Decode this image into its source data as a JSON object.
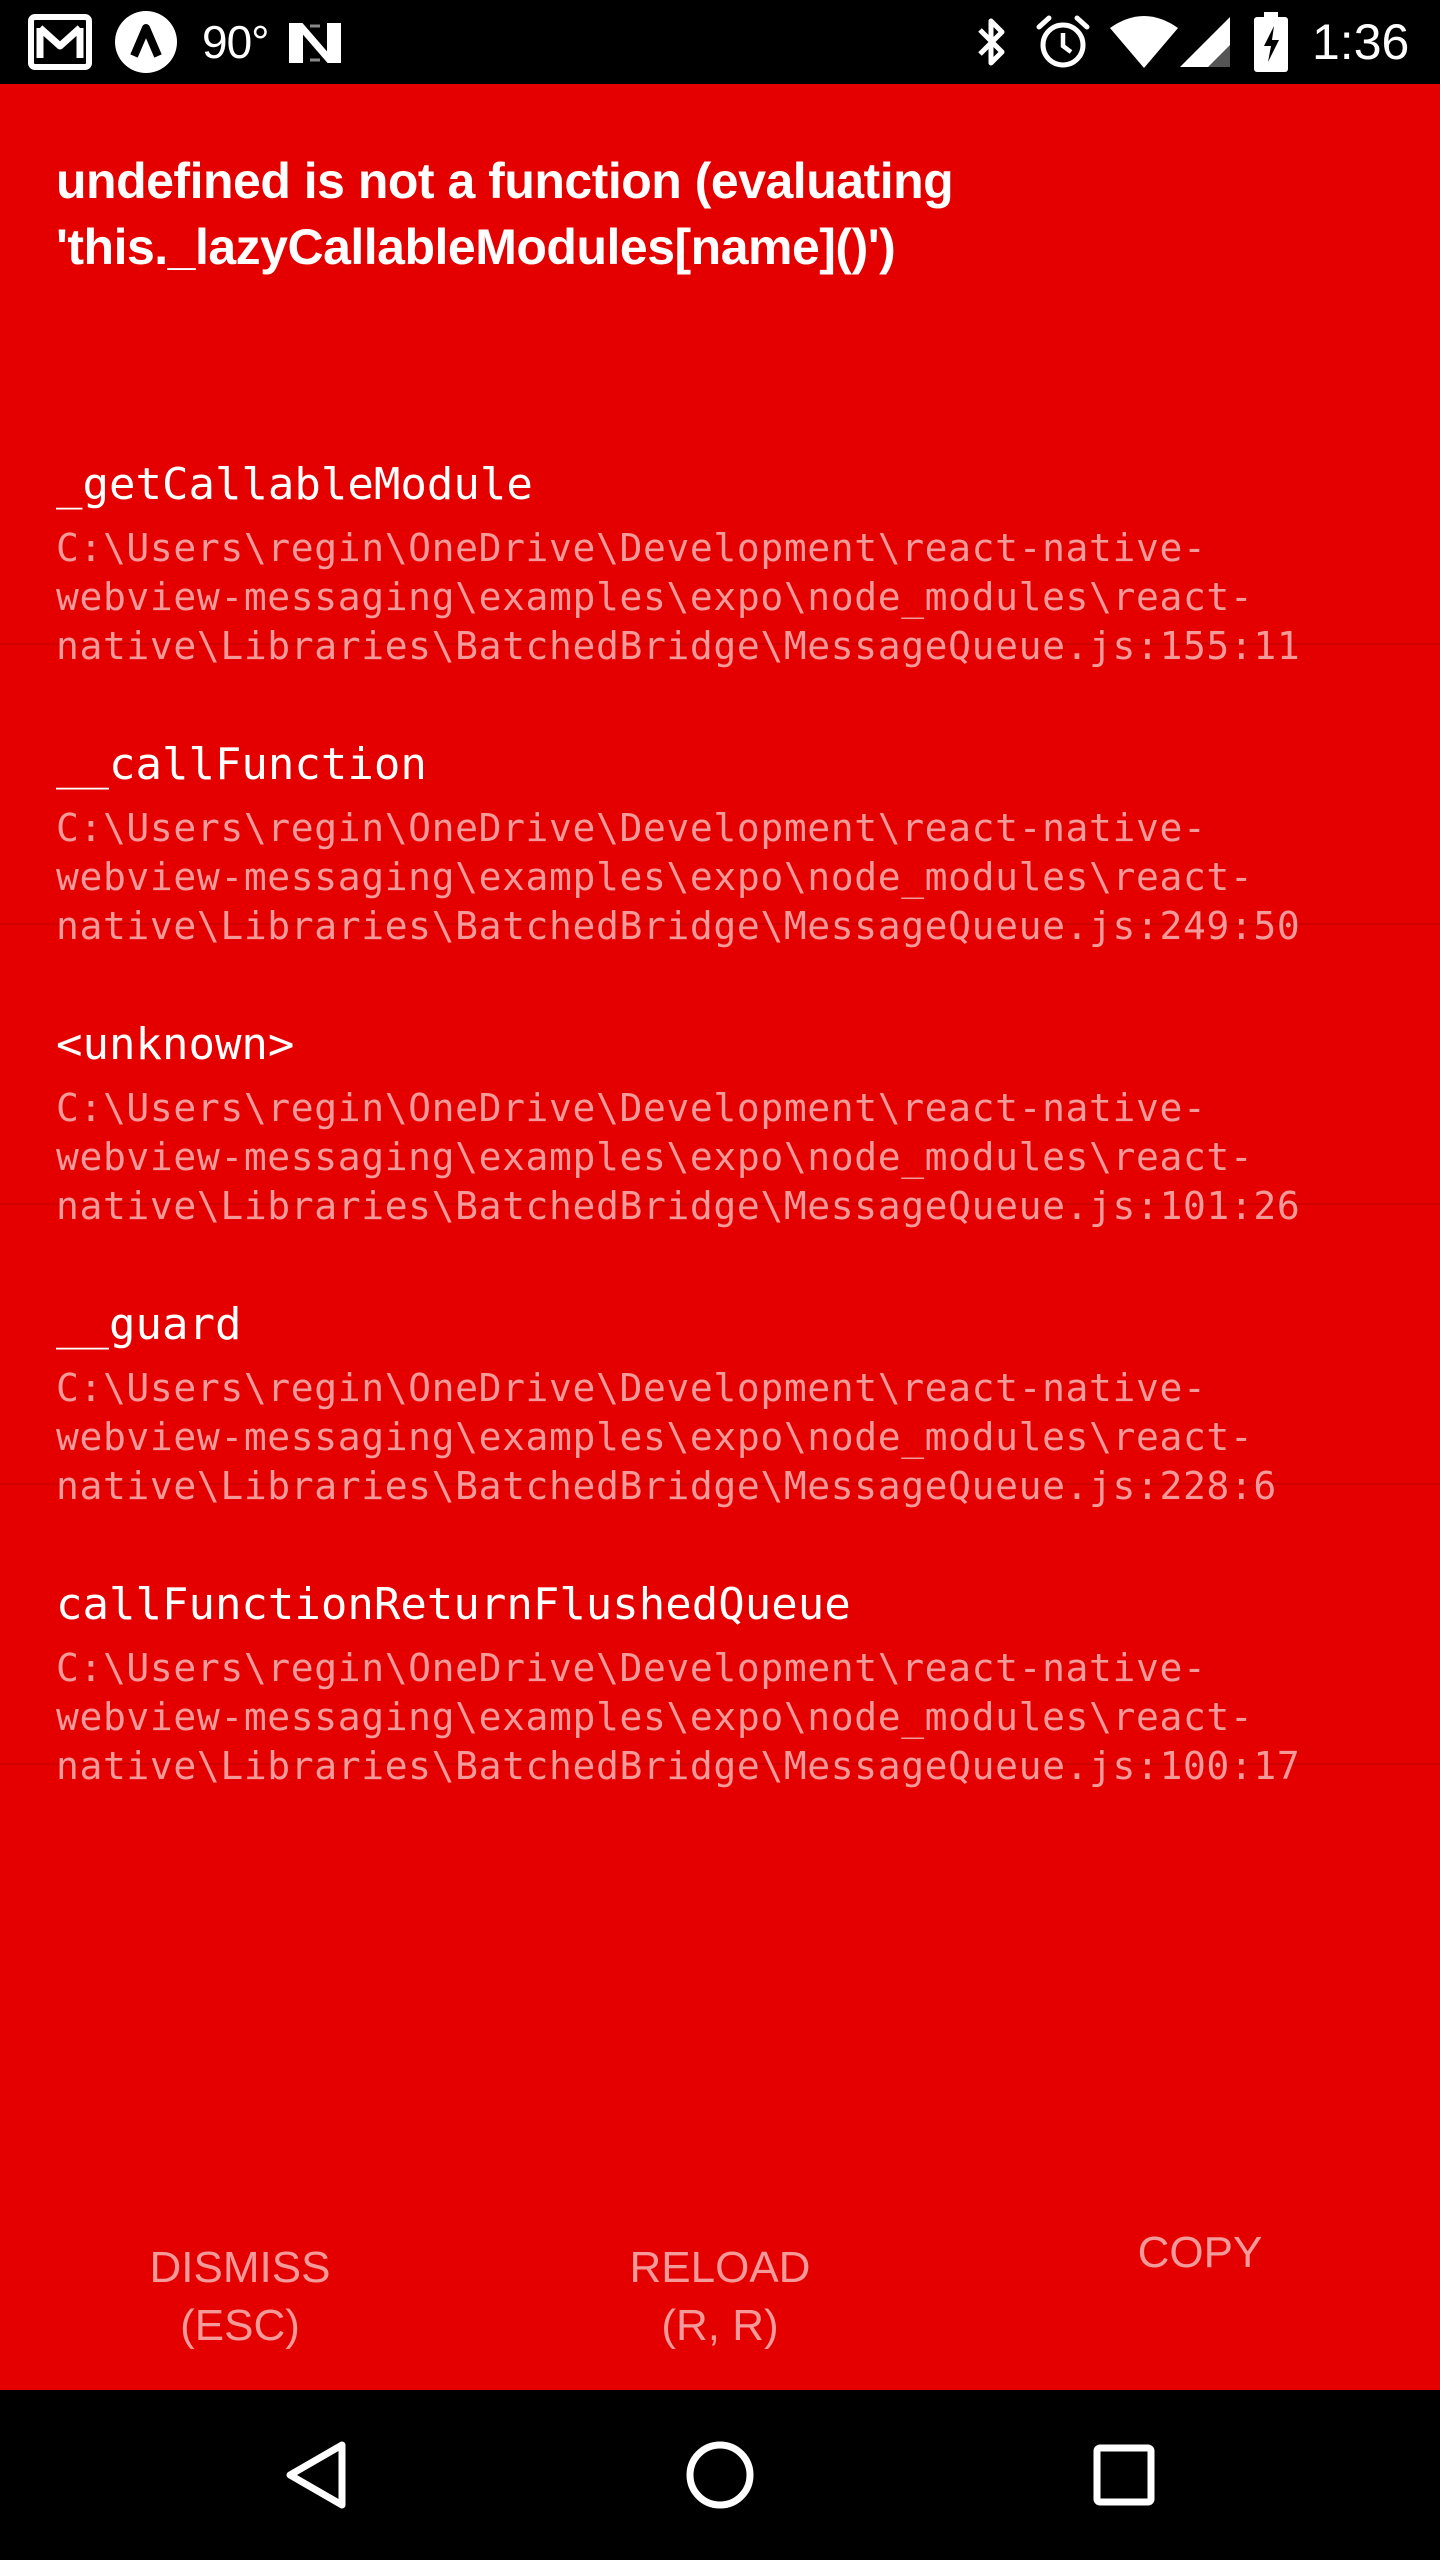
{
  "status_bar": {
    "temperature": "90°",
    "time": "1:36",
    "icons": [
      "gmail-icon",
      "app-a-icon",
      "n-app-icon",
      "bluetooth-icon",
      "alarm-icon",
      "wifi-icon",
      "cell-signal-icon",
      "battery-charging-icon"
    ]
  },
  "error": {
    "title": "undefined is not a function (evaluating 'this._lazyCallableModules[name]()')"
  },
  "stack": [
    {
      "method": "_getCallableModule",
      "file_lines": [
        "C:\\Users\\regin\\OneDrive\\Development\\react-native-",
        "webview-messaging\\examples\\expo\\node_modules\\react-",
        "native\\Libraries\\BatchedBridge\\MessageQueue.js:155:11"
      ]
    },
    {
      "method": "__callFunction",
      "file_lines": [
        "C:\\Users\\regin\\OneDrive\\Development\\react-native-",
        "webview-messaging\\examples\\expo\\node_modules\\react-",
        "native\\Libraries\\BatchedBridge\\MessageQueue.js:249:50"
      ]
    },
    {
      "method": "<unknown>",
      "file_lines": [
        "C:\\Users\\regin\\OneDrive\\Development\\react-native-",
        "webview-messaging\\examples\\expo\\node_modules\\react-",
        "native\\Libraries\\BatchedBridge\\MessageQueue.js:101:26"
      ]
    },
    {
      "method": "__guard",
      "file_lines": [
        "C:\\Users\\regin\\OneDrive\\Development\\react-native-",
        "webview-messaging\\examples\\expo\\node_modules\\react-",
        "native\\Libraries\\BatchedBridge\\MessageQueue.js:228:6"
      ]
    },
    {
      "method": "callFunctionReturnFlushedQueue",
      "file_lines": [
        "C:\\Users\\regin\\OneDrive\\Development\\react-native-",
        "webview-messaging\\examples\\expo\\node_modules\\react-",
        "native\\Libraries\\BatchedBridge\\MessageQueue.js:100:17"
      ]
    }
  ],
  "buttons": {
    "dismiss": {
      "line1": "DISMISS",
      "line2": "(ESC)"
    },
    "reload": {
      "line1": "RELOAD",
      "line2": "(R, R)"
    },
    "copy": {
      "line1": "COPY"
    }
  },
  "nav_bar": {
    "icons": [
      "back-icon",
      "home-icon",
      "recents-icon"
    ]
  },
  "colors": {
    "background_red": "#e50000",
    "stack_file_text": "#f49a9a",
    "button_text": "#f49a9a",
    "divider": "#cf0000"
  }
}
